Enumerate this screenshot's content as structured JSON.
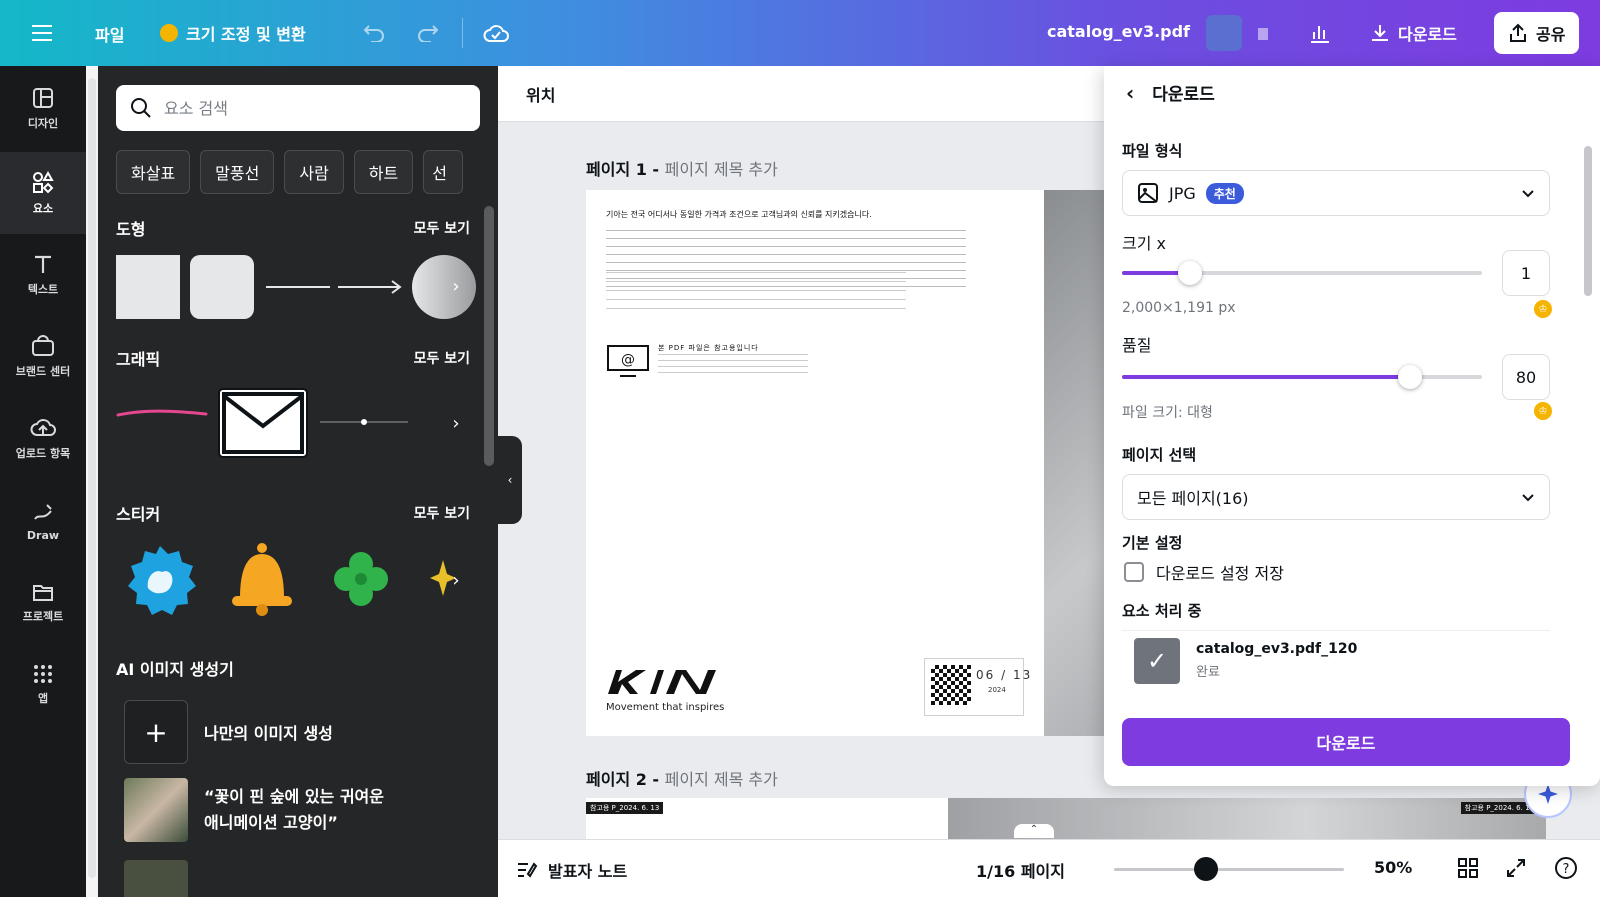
{
  "topbar": {
    "file_label": "파일",
    "resize_label": "크기 조정 및 변환",
    "filename": "catalog_ev3.pdf",
    "download_label": "다운로드",
    "share_label": "공유"
  },
  "rail": {
    "items": [
      {
        "label": "디자인",
        "icon": "layout-icon"
      },
      {
        "label": "요소",
        "icon": "shapes-icon"
      },
      {
        "label": "텍스트",
        "icon": "text-icon"
      },
      {
        "label": "브랜드 센터",
        "icon": "brand-icon"
      },
      {
        "label": "업로드 항목",
        "icon": "upload-icon"
      },
      {
        "label": "Draw",
        "icon": "draw-icon"
      },
      {
        "label": "프로젝트",
        "icon": "folder-icon"
      },
      {
        "label": "앱",
        "icon": "apps-icon"
      }
    ]
  },
  "panel": {
    "search_placeholder": "요소 검색",
    "chips": [
      "화살표",
      "말풍선",
      "사람",
      "하트",
      "선"
    ],
    "shapes_title": "도형",
    "graphics_title": "그래픽",
    "stickers_title": "스티커",
    "see_all": "모두 보기",
    "ai_title": "AI 이미지 생성기",
    "ai_create": "나만의 이미지 생성",
    "ai_prompt_line1": "“꽃이 핀 숲에 있는 귀여운",
    "ai_prompt_line2": "애니메이션 고양이”"
  },
  "canvas": {
    "location_title": "위치",
    "page1_label": "페이지 1 -",
    "page1_placeholder": "페이지 제목 추가",
    "page2_label": "페이지 2 -",
    "page2_placeholder": "페이지 제목 추가",
    "page1_headline": "기아는 전국 어디서나 동일한 가격과 조건으로 고객님과의 신뢰를 지키겠습니다.",
    "page1_notice": "본 PDF 파일은 참고용입니다",
    "kia_tagline": "Movement that inspires",
    "page_counter": "06 / 13",
    "page_year": "2024",
    "page2_tag": "참고용 P_2024. 6. 13",
    "page2_tag_right": "참고용 P_2024. 6. 13"
  },
  "bottom": {
    "notes_label": "발표자 노트",
    "page_indicator": "1/16 페이지",
    "zoom": "50%",
    "zoom_level": 0.4
  },
  "download": {
    "title": "다운로드",
    "format_label": "파일 형식",
    "format_value": "JPG",
    "recommended": "추천",
    "size_label": "크기 x",
    "size_value": "1",
    "size_level": 0.19,
    "dimensions": "2,000×1,191 px",
    "quality_label": "품질",
    "quality_value": "80",
    "quality_level": 0.8,
    "filesize": "파일 크기: 대형",
    "page_select_label": "페이지 선택",
    "page_select_value": "모든 페이지(16)",
    "defaults_label": "기본 설정",
    "save_settings": "다운로드 설정 저장",
    "processing_label": "요소 처리 중",
    "processing_file": "catalog_ev3.pdf_120",
    "processing_status": "완료",
    "download_button": "다운로드"
  },
  "colors": {
    "accent": "#7d3be0",
    "badge": "#3b5bdb",
    "sticker_blue": "#1fa3e0",
    "sticker_bell": "#f5a623",
    "sticker_clover": "#2fb34a"
  }
}
